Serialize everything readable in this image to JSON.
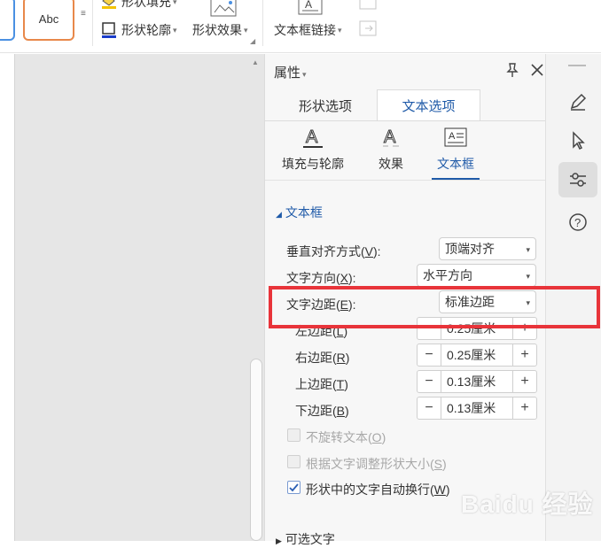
{
  "ribbon": {
    "style_thumb_text": "Abc",
    "shape_fill": "形状填充",
    "shape_outline": "形状轮廓",
    "shape_effect": "形状效果",
    "textbox_link": "文本框链接"
  },
  "panel": {
    "title": "属性",
    "tabs": [
      {
        "label": "形状选项",
        "active": false
      },
      {
        "label": "文本选项",
        "active": true
      }
    ],
    "subtabs": [
      {
        "label": "填充与轮廓",
        "icon": "text-fill-outline-icon"
      },
      {
        "label": "效果",
        "icon": "text-effect-icon"
      },
      {
        "label": "文本框",
        "icon": "textbox-icon",
        "active": true
      }
    ],
    "section_title": "文本框",
    "vertical_align": {
      "label": "垂直对齐方式",
      "key": "V",
      "value": "顶端对齐"
    },
    "text_direction": {
      "label": "文字方向",
      "key": "X",
      "value": "水平方向"
    },
    "text_margin": {
      "label": "文字边距",
      "key": "E",
      "value": "标准边距"
    },
    "margins": [
      {
        "label": "左边距",
        "key": "L",
        "value": "0.25厘米"
      },
      {
        "label": "右边距",
        "key": "R",
        "value": "0.25厘米"
      },
      {
        "label": "上边距",
        "key": "T",
        "value": "0.13厘米"
      },
      {
        "label": "下边距",
        "key": "B",
        "value": "0.13厘米"
      }
    ],
    "checkboxes": [
      {
        "label": "不旋转文本",
        "key": "O",
        "checked": false,
        "disabled": true
      },
      {
        "label": "根据文字调整形状大小",
        "key": "S",
        "checked": false,
        "disabled": true
      },
      {
        "label": "形状中的文字自动换行",
        "key": "W",
        "checked": true,
        "disabled": false
      }
    ],
    "next_section": "可选文字"
  },
  "rail_icons": [
    "pen-icon",
    "cursor-icon",
    "settings-sliders-icon",
    "help-icon"
  ],
  "watermark": "Baidu 经验",
  "colors": {
    "accent": "#1f5aa8",
    "highlight": "#e8343a"
  }
}
